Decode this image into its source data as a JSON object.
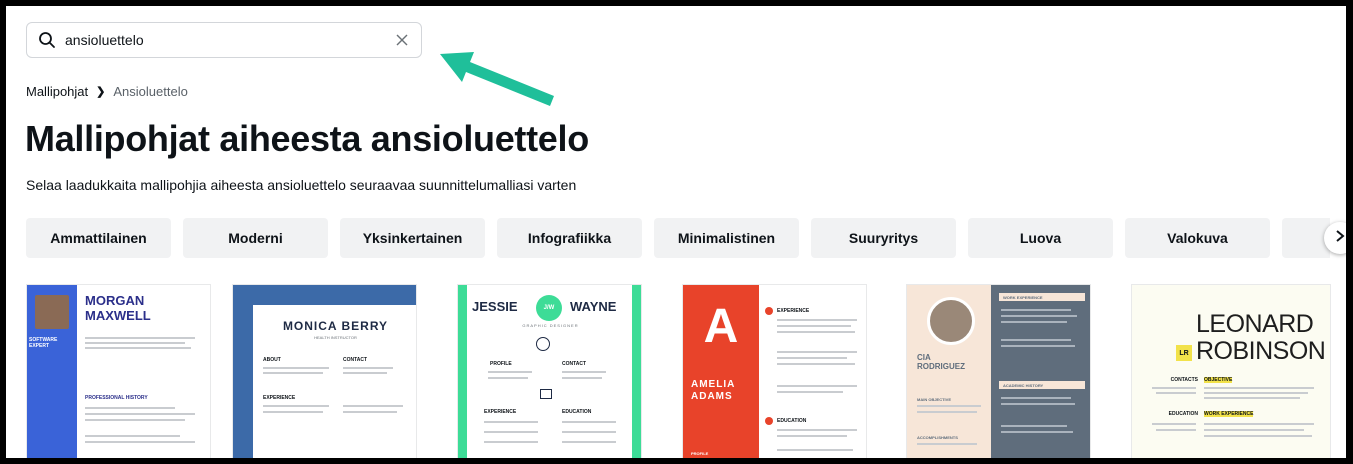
{
  "search": {
    "value": "ansioluettelo",
    "placeholder": ""
  },
  "breadcrumb": {
    "root": "Mallipohjat",
    "current": "Ansioluettelo"
  },
  "page": {
    "title": "Mallipohjat aiheesta ansioluettelo",
    "subtitle": "Selaa laadukkaita mallipohjia aiheesta ansioluettelo seuraavaa suunnittelumalliasi varten"
  },
  "filters": [
    "Ammattilainen",
    "Moderni",
    "Yksinkertainen",
    "Infografiikka",
    "Minimalistinen",
    "Suuryritys",
    "Luova",
    "Valokuva"
  ],
  "templates": [
    {
      "name_line1": "MORGAN",
      "name_line2": "MAXWELL",
      "role": "SOFTWARE EXPERT",
      "section": "PROFESSIONAL HISTORY"
    },
    {
      "name": "MONICA BERRY",
      "role": "HEALTH INSTRUCTOR",
      "col1": "ABOUT",
      "col2": "CONTACT",
      "col3": "EXPERIENCE"
    },
    {
      "first": "JESSIE",
      "last": "WAYNE",
      "monogram": "J/W",
      "role": "GRAPHIC DESIGNER",
      "col1": "PROFILE",
      "col2": "CONTACT",
      "col3": "EXPERIENCE",
      "col4": "EDUCATION"
    },
    {
      "letter": "A",
      "name_line1": "AMELIA",
      "name_line2": "ADAMS",
      "section1": "EXPERIENCE",
      "section2": "EDUCATION",
      "section3": "PROFILE"
    },
    {
      "name_line1": "CIA",
      "name_line2": "RODRIGUEZ",
      "section1": "WORK EXPERIENCE",
      "section2": "ACADEMIC HISTORY",
      "section3": "MAIN OBJECTIVE",
      "section4": "ACCOMPLISHMENTS"
    },
    {
      "name_line1": "LEONARD",
      "name_line2": "ROBINSON",
      "monogram": "LR",
      "section1": "CONTACTS",
      "section2": "OBJECTIVE",
      "section3": "EDUCATION",
      "section4": "WORK EXPERIENCE"
    }
  ],
  "colors": {
    "accent_arrow": "#1fbf9a",
    "chip_bg": "#f1f2f3",
    "amelia_red": "#e8432a",
    "jessie_green": "#3ddc97",
    "morgan_blue": "#3a63d8",
    "cia_slate": "#5f6d7c"
  }
}
